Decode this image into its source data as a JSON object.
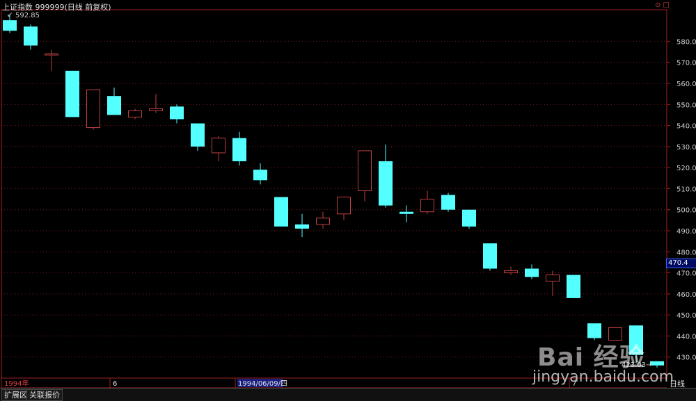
{
  "header": {
    "title": "上证指数 999999(日线 前复权)",
    "controls": "⊙ □"
  },
  "max_label": "592.85",
  "last_label": "423.03",
  "current_tag": "470.4",
  "bottom": {
    "tabs": [
      "扩展区",
      "关联报价"
    ],
    "period": "日线"
  },
  "watermark": {
    "line1": "Bai 经验",
    "line2": "jingyan.baidu.com"
  },
  "colors": {
    "up": "#c04040",
    "down": "#54ffff",
    "grid": "#7a1a1a",
    "axis": "#a02020"
  },
  "chart_data": {
    "type": "candlestick",
    "y_axis": {
      "ticks": [
        430,
        440,
        450,
        460,
        470,
        480,
        490,
        500,
        510,
        520,
        530,
        540,
        550,
        560,
        570,
        580
      ],
      "range": [
        420,
        595
      ]
    },
    "x_axis_labels": [
      {
        "label": "1994年",
        "index": 0
      },
      {
        "label": "6",
        "index": 5
      },
      {
        "label": "1994/06/09/四",
        "index": 11
      },
      {
        "label": "7",
        "index": 27
      }
    ],
    "candles": [
      {
        "o": 590,
        "h": 592.85,
        "l": 584,
        "c": 585
      },
      {
        "o": 587,
        "h": 588,
        "l": 576,
        "c": 578
      },
      {
        "o": 574,
        "h": 576,
        "l": 566,
        "c": 574
      },
      {
        "o": 566,
        "h": 566,
        "l": 544,
        "c": 544
      },
      {
        "o": 539,
        "h": 557,
        "l": 538,
        "c": 557
      },
      {
        "o": 554,
        "h": 558,
        "l": 545,
        "c": 545
      },
      {
        "o": 544,
        "h": 548,
        "l": 543,
        "c": 547
      },
      {
        "o": 547,
        "h": 555,
        "l": 546,
        "c": 548
      },
      {
        "o": 549,
        "h": 550,
        "l": 541,
        "c": 543
      },
      {
        "o": 541,
        "h": 541,
        "l": 528,
        "c": 530
      },
      {
        "o": 527,
        "h": 535,
        "l": 523,
        "c": 534
      },
      {
        "o": 534,
        "h": 537,
        "l": 521,
        "c": 523
      },
      {
        "o": 519,
        "h": 522,
        "l": 512,
        "c": 514
      },
      {
        "o": 506,
        "h": 506,
        "l": 492,
        "c": 492
      },
      {
        "o": 493,
        "h": 498,
        "l": 487,
        "c": 491
      },
      {
        "o": 493,
        "h": 499,
        "l": 491,
        "c": 496
      },
      {
        "o": 498,
        "h": 506,
        "l": 495,
        "c": 506
      },
      {
        "o": 509,
        "h": 528,
        "l": 504,
        "c": 528
      },
      {
        "o": 523,
        "h": 531,
        "l": 501,
        "c": 502
      },
      {
        "o": 499,
        "h": 502,
        "l": 494,
        "c": 498
      },
      {
        "o": 499,
        "h": 509,
        "l": 498,
        "c": 505
      },
      {
        "o": 507,
        "h": 508,
        "l": 499,
        "c": 500
      },
      {
        "o": 500,
        "h": 500,
        "l": 491,
        "c": 492
      },
      {
        "o": 484,
        "h": 484,
        "l": 471,
        "c": 472
      },
      {
        "o": 470,
        "h": 473,
        "l": 469,
        "c": 471
      },
      {
        "o": 472,
        "h": 474,
        "l": 467,
        "c": 468
      },
      {
        "o": 466,
        "h": 471,
        "l": 459,
        "c": 469
      },
      {
        "o": 469,
        "h": 469,
        "l": 458,
        "c": 458
      },
      {
        "o": 446,
        "h": 446,
        "l": 438,
        "c": 439
      },
      {
        "o": 438,
        "h": 444,
        "l": 438,
        "c": 444
      },
      {
        "o": 445,
        "h": 445,
        "l": 427,
        "c": 431
      },
      {
        "o": 428,
        "h": 428,
        "l": 425,
        "c": 426
      }
    ]
  }
}
